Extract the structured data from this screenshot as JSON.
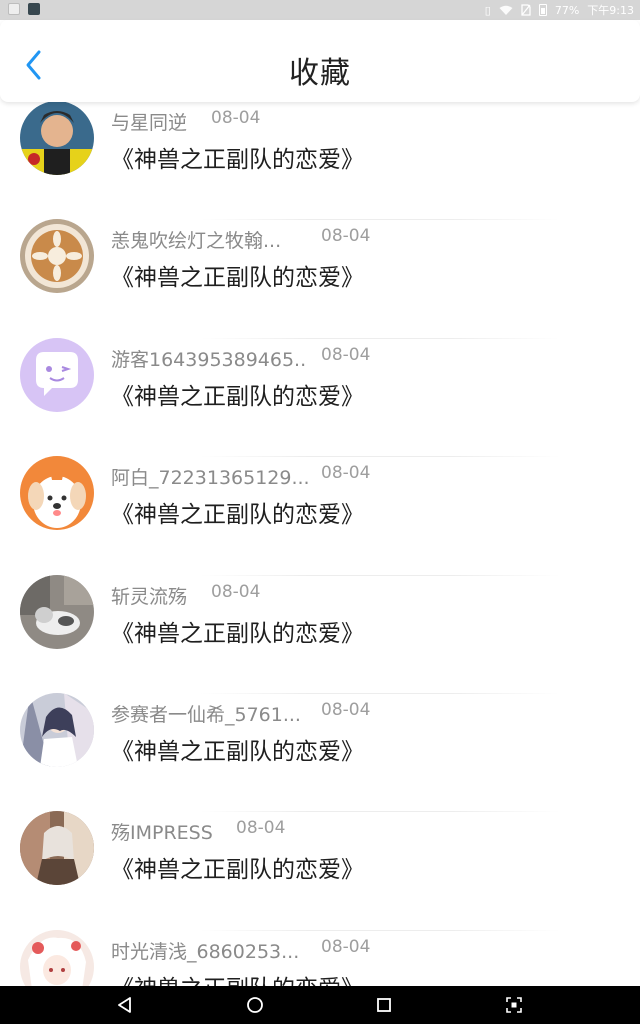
{
  "statusbar": {
    "battery": "77%",
    "time": "下午9:13"
  },
  "header": {
    "title": "收藏",
    "back_icon": "chevron-left-icon",
    "accent": "#2196f3"
  },
  "items": [
    {
      "name": "与星同逆",
      "date": "08-04",
      "book": "《神兽之正副队的恋爱》"
    },
    {
      "name": "恙鬼吹绘灯之牧翰...",
      "date": "08-04",
      "book": "《神兽之正副队的恋爱》"
    },
    {
      "name": "游客164395389465..",
      "date": "08-04",
      "book": "《神兽之正副队的恋爱》"
    },
    {
      "name": "阿白_72231365129...",
      "date": "08-04",
      "book": "《神兽之正副队的恋爱》"
    },
    {
      "name": "斩灵流殇",
      "date": "08-04",
      "book": "《神兽之正副队的恋爱》"
    },
    {
      "name": "参赛者一仙希_5761...",
      "date": "08-04",
      "book": "《神兽之正副队的恋爱》"
    },
    {
      "name": "殇IMPRESS",
      "date": "08-04",
      "book": "《神兽之正副队的恋爱》"
    },
    {
      "name": "时光清浅_6860253...",
      "date": "08-04",
      "book": "《神兽之正副队的恋爱》"
    }
  ],
  "navbar": {
    "icons": [
      "back-triangle-icon",
      "home-circle-icon",
      "recents-square-icon",
      "screenshot-icon"
    ]
  }
}
